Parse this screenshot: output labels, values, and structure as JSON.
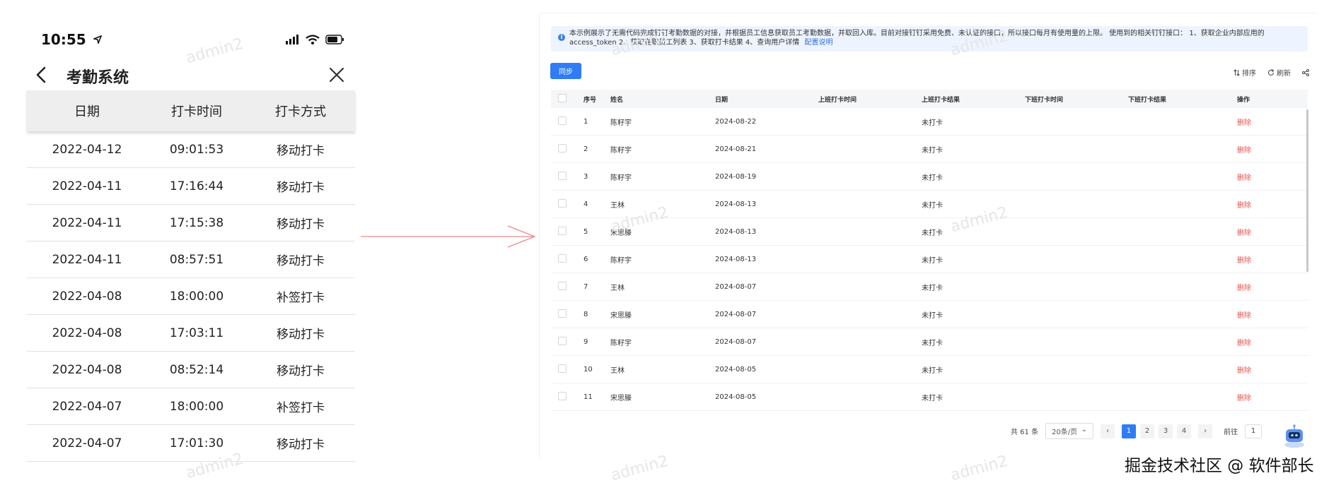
{
  "phone": {
    "status_time": "10:55",
    "nav_title": "考勤系统",
    "columns": [
      "日期",
      "打卡时间",
      "打卡方式"
    ],
    "rows": [
      [
        "2022-04-12",
        "09:01:53",
        "移动打卡"
      ],
      [
        "2022-04-11",
        "17:16:44",
        "移动打卡"
      ],
      [
        "2022-04-11",
        "17:15:38",
        "移动打卡"
      ],
      [
        "2022-04-11",
        "08:57:51",
        "移动打卡"
      ],
      [
        "2022-04-08",
        "18:00:00",
        "补签打卡"
      ],
      [
        "2022-04-08",
        "17:03:11",
        "移动打卡"
      ],
      [
        "2022-04-08",
        "08:52:14",
        "移动打卡"
      ],
      [
        "2022-04-07",
        "18:00:00",
        "补签打卡"
      ],
      [
        "2022-04-07",
        "17:01:30",
        "移动打卡"
      ]
    ]
  },
  "panel": {
    "info_text": "本示例展示了无需代码完成钉钉考勤数据的对接，并根据员工信息获取员工考勤数据，并取回入库。目前对接钉钉采用免费、未认证的接口，所以接口每月有使用量的上限。 使用到的相关钉钉接口： 1、获取企业内部应用的access_token 2、获取在职员工列表 3、获取打卡结果 4、查询用户详情",
    "info_link": "配置说明",
    "sync_label": "同步",
    "tools": {
      "sort": "排序",
      "refresh": "刷新"
    },
    "columns": [
      "序号",
      "姓名",
      "日期",
      "上班打卡时间",
      "上班打卡结果",
      "下班打卡时间",
      "下班打卡结果",
      "操作"
    ],
    "rows": [
      {
        "no": "1",
        "name": "陈籽宇",
        "date": "2024-08-22",
        "in_time": "",
        "in_result": "未打卡",
        "out_time": "",
        "out_result": "",
        "op": "删除"
      },
      {
        "no": "2",
        "name": "陈籽宇",
        "date": "2024-08-21",
        "in_time": "",
        "in_result": "未打卡",
        "out_time": "",
        "out_result": "",
        "op": "删除"
      },
      {
        "no": "3",
        "name": "陈籽宇",
        "date": "2024-08-19",
        "in_time": "",
        "in_result": "未打卡",
        "out_time": "",
        "out_result": "",
        "op": "删除"
      },
      {
        "no": "4",
        "name": "王林",
        "date": "2024-08-13",
        "in_time": "",
        "in_result": "未打卡",
        "out_time": "",
        "out_result": "",
        "op": "删除"
      },
      {
        "no": "5",
        "name": "宋思滕",
        "date": "2024-08-13",
        "in_time": "",
        "in_result": "未打卡",
        "out_time": "",
        "out_result": "",
        "op": "删除"
      },
      {
        "no": "6",
        "name": "陈籽宇",
        "date": "2024-08-13",
        "in_time": "",
        "in_result": "未打卡",
        "out_time": "",
        "out_result": "",
        "op": "删除"
      },
      {
        "no": "7",
        "name": "王林",
        "date": "2024-08-07",
        "in_time": "",
        "in_result": "未打卡",
        "out_time": "",
        "out_result": "",
        "op": "删除"
      },
      {
        "no": "8",
        "name": "宋思滕",
        "date": "2024-08-07",
        "in_time": "",
        "in_result": "未打卡",
        "out_time": "",
        "out_result": "",
        "op": "删除"
      },
      {
        "no": "9",
        "name": "陈籽宇",
        "date": "2024-08-07",
        "in_time": "",
        "in_result": "未打卡",
        "out_time": "",
        "out_result": "",
        "op": "删除"
      },
      {
        "no": "10",
        "name": "王林",
        "date": "2024-08-05",
        "in_time": "",
        "in_result": "未打卡",
        "out_time": "",
        "out_result": "",
        "op": "删除"
      },
      {
        "no": "11",
        "name": "宋思滕",
        "date": "2024-08-05",
        "in_time": "",
        "in_result": "未打卡",
        "out_time": "",
        "out_result": "",
        "op": "删除"
      }
    ],
    "pager": {
      "total": "共 61 条",
      "page_size": "20条/页",
      "pages": [
        "1",
        "2",
        "3",
        "4"
      ],
      "active_page": "1",
      "goto_label": "前往",
      "goto_value": "1"
    }
  },
  "watermark": "admin2",
  "credit": "掘金技术社区 @ 软件部长",
  "colors": {
    "primary": "#2f7cf6",
    "danger": "#e0554f",
    "arrow": "#e88a8a"
  }
}
